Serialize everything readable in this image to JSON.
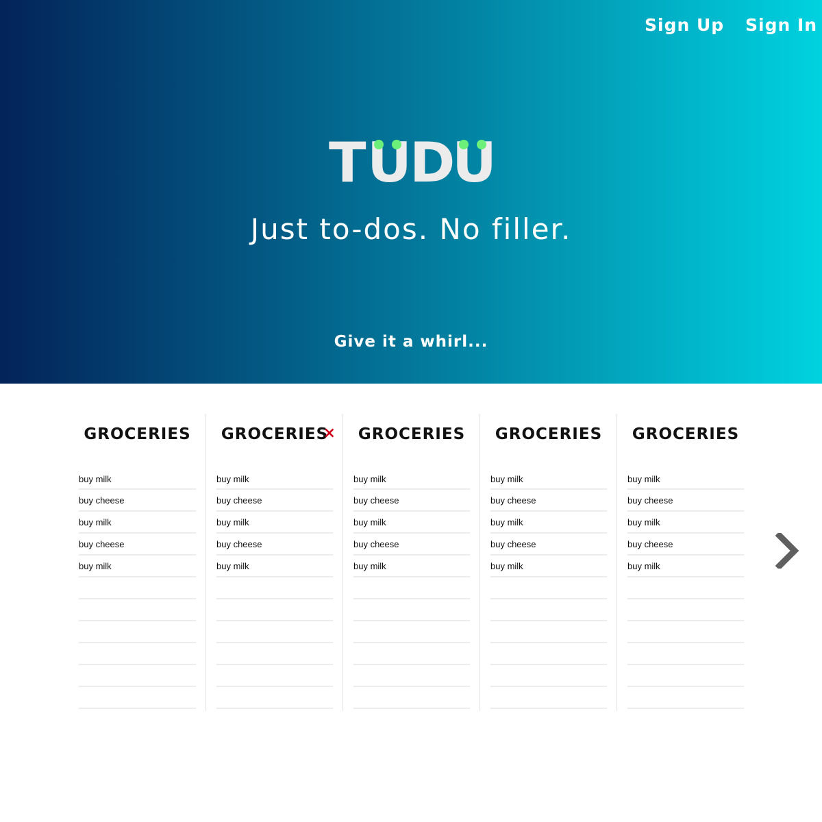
{
  "nav": {
    "sign_up": "Sign Up",
    "sign_in": "Sign In"
  },
  "logo": {
    "letters": [
      "T",
      "U",
      "D",
      "U"
    ]
  },
  "hero": {
    "tagline": "Just to-dos. No filler.",
    "cta": "Give it a whirl..."
  },
  "lists": [
    {
      "title": "GROCERIES",
      "items": [
        "buy milk",
        "buy cheese",
        "buy milk",
        "buy cheese",
        "buy milk",
        "",
        "",
        "",
        "",
        "",
        ""
      ]
    },
    {
      "title": "GROCERIES",
      "delete": "×",
      "items": [
        "buy milk",
        "buy cheese",
        "buy milk",
        "buy cheese",
        "buy milk",
        "",
        "",
        "",
        "",
        "",
        ""
      ]
    },
    {
      "title": "GROCERIES",
      "items": [
        "buy milk",
        "buy cheese",
        "buy milk",
        "buy cheese",
        "buy milk",
        "",
        "",
        "",
        "",
        "",
        ""
      ]
    },
    {
      "title": "GROCERIES",
      "items": [
        "buy milk",
        "buy cheese",
        "buy milk",
        "buy cheese",
        "buy milk",
        "",
        "",
        "",
        "",
        "",
        ""
      ]
    },
    {
      "title": "GROCERIES",
      "items": [
        "buy milk",
        "buy cheese",
        "buy milk",
        "buy cheese",
        "buy milk",
        "",
        "",
        "",
        "",
        "",
        ""
      ]
    }
  ],
  "icons": {
    "next": "chevron-right-icon",
    "delete": "close-icon"
  },
  "colors": {
    "accent_dot": "#6df07a",
    "delete": "#d0021b",
    "gradient_start": "#03235a",
    "gradient_end": "#00d2e0"
  }
}
